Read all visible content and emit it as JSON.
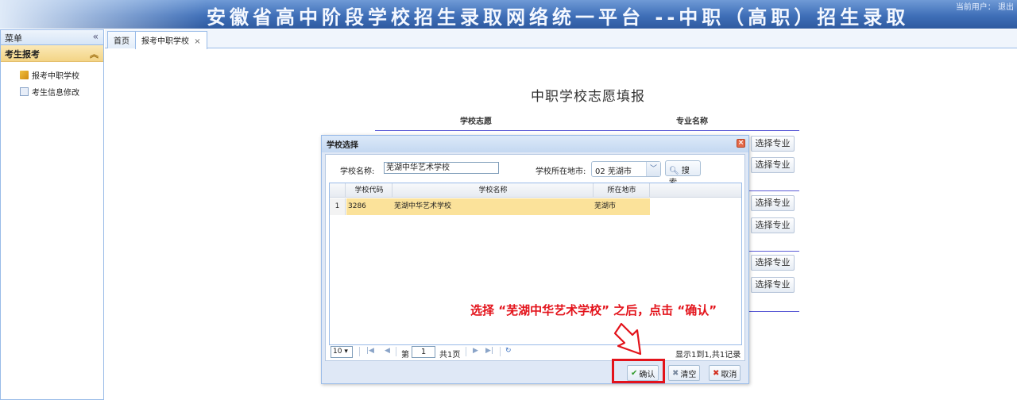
{
  "header": {
    "title": "安徽省高中阶段学校招生录取网络统一平台 --中职（高职）招生录取",
    "user_fragment": "当前用户：    退出"
  },
  "sidebar": {
    "title": "菜单",
    "collapse_icon": "double-chevron-left-icon",
    "section": "考生报考",
    "items": [
      {
        "label": "报考中职学校",
        "icon": "flag-icon"
      },
      {
        "label": "考生信息修改",
        "icon": "document-icon"
      }
    ]
  },
  "tabs": [
    {
      "label": "首页"
    },
    {
      "label": "报考中职学校",
      "close": "×"
    }
  ],
  "main": {
    "title": "中职学校志愿填报",
    "columns": [
      "学校志愿",
      "专业名称"
    ],
    "select_major_label": "选择专业"
  },
  "dialog": {
    "title": "学校选择",
    "school_name_label": "学校名称:",
    "school_name_value": "芜湖中华艺术学校",
    "city_label": "学校所在地市:",
    "city_value": "02   芜湖市",
    "search_label": "搜索",
    "grid": {
      "headers": [
        "学校代码",
        "学校名称",
        "所在地市"
      ],
      "rows": [
        {
          "index": "1",
          "code": "3286",
          "name": "芜湖中华艺术学校",
          "city": "芜湖市"
        }
      ]
    },
    "pager": {
      "page_size": "10",
      "page_prefix": "第",
      "page_value": "1",
      "page_suffix": "共1页",
      "summary": "显示1到1,共1记录"
    },
    "buttons": {
      "confirm": "确认",
      "clear": "清空",
      "cancel": "取消"
    }
  },
  "annotation": {
    "text": "选择 “芜湖中华艺术学校” 之后，点击 “确认”",
    "color": "#e3131b"
  }
}
